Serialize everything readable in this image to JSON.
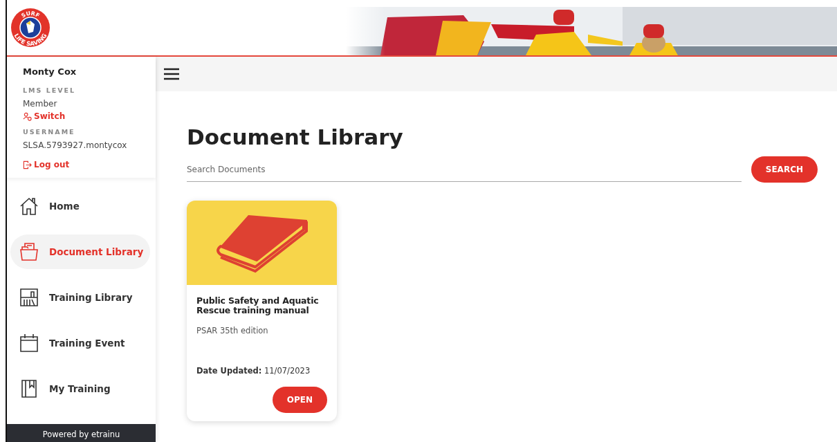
{
  "logo": {
    "top_text": "SURF",
    "bottom_text": "LIFE SAVING"
  },
  "user": {
    "name": "Monty Cox",
    "level_label": "LMS LEVEL",
    "level": "Member",
    "switch": "Switch",
    "username_label": "USERNAME",
    "username": "SLSA.5793927.montycox",
    "logout": "Log out"
  },
  "nav": [
    {
      "label": "Home",
      "selected": false
    },
    {
      "label": "Document Library",
      "selected": true
    },
    {
      "label": "Training Library",
      "selected": false
    },
    {
      "label": "Training Event",
      "selected": false
    },
    {
      "label": "My Training",
      "selected": false
    }
  ],
  "footer": "Powered by etrainu",
  "page_title": "Document Library",
  "search": {
    "placeholder": "Search Documents",
    "button": "SEARCH"
  },
  "documents": [
    {
      "title": "Public Safety and Aquatic Rescue training manual",
      "subtitle": "PSAR 35th edition",
      "date": "**Date Updated:** 11/07/2023",
      "button": "OPEN"
    }
  ]
}
